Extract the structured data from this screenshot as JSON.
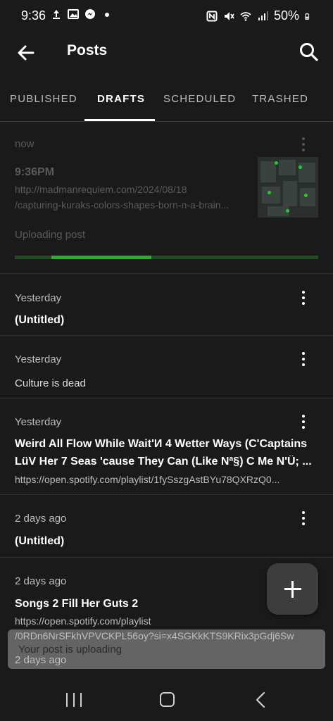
{
  "status_bar": {
    "time": "9:36",
    "battery": "50%",
    "left_icons": [
      "upload-icon",
      "image-icon",
      "messenger-icon",
      "dot-icon"
    ],
    "right_icons": [
      "nfc-icon",
      "mute-icon",
      "wifi-icon",
      "signal-icon",
      "battery-icon"
    ]
  },
  "app_bar": {
    "title": "Posts",
    "back_icon": "arrow-left-icon",
    "search_icon": "search-icon"
  },
  "tabs": [
    {
      "label": "PUBLISHED",
      "active": false
    },
    {
      "label": "DRAFTS",
      "active": true
    },
    {
      "label": "SCHEDULED",
      "active": false
    },
    {
      "label": "TRASHED",
      "active": false
    }
  ],
  "posts": [
    {
      "date": "now",
      "time": "9:36PM",
      "url_line1": "http://madmanrequiem.com/2024/08/18",
      "url_line2": "/capturing-kuraks-colors-shapes-born-n-a-brain...",
      "status": "Uploading post",
      "progress_start": 0.12,
      "progress_end": 0.45
    },
    {
      "date": "Yesterday",
      "title": "(Untitled)"
    },
    {
      "date": "Yesterday",
      "text": "Culture is dead"
    },
    {
      "date": "Yesterday",
      "title_line1": "Weird All Flow While Wait'И 4 Wetter Ways (C'Captains",
      "title_line2": "LüV Her 7 Seas 'cause They Can (Like Nª§) C Me N'Ü; ...",
      "url": "https://open.spotify.com/playlist/1fySszgAstBYu78QXRzQ0..."
    },
    {
      "date": "2 days ago",
      "title": "(Untitled)"
    },
    {
      "date": "2 days ago",
      "title": "Songs 2 Fill Her Guts 2",
      "url_line1": "https://open.spotify.com/playlist",
      "url_line2": "/0RDn6NrSFkhVPVCKPL56oy?si=x4SGKkKTS9KRix3pGdj6Sw"
    },
    {
      "date": "2 days ago"
    }
  ],
  "snackbar": {
    "text": "Your post is uploading"
  },
  "fab": {
    "icon": "plus-icon"
  },
  "nav_bar": {
    "icons": [
      "recents-icon",
      "home-icon",
      "back-icon"
    ]
  }
}
